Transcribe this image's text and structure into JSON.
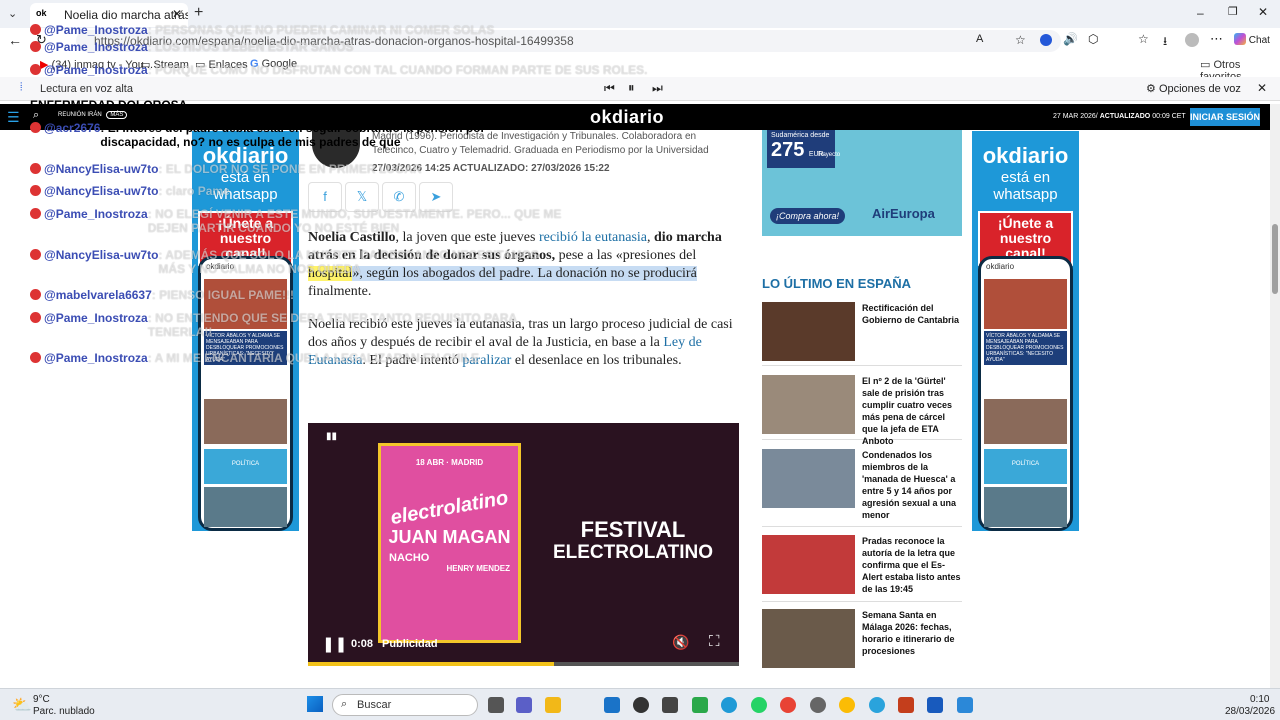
{
  "browser": {
    "tab_title": "Noelia dio marcha atrás en la",
    "url": "https://okdiario.com/espana/noelia-dio-marcha-atras-donacion-organos-hospital-16499358",
    "bookmarks": [
      "(34) inmaq tv - You...",
      "Stream",
      "Enlaces",
      "Google"
    ],
    "other_favorites": "Otros favoritos",
    "chat_label": "Chat"
  },
  "readaloud": {
    "label": "Lectura en voz alta",
    "voice_options": "Opciones de voz"
  },
  "site": {
    "logo": "okdiario",
    "ticker": "REUNIÓN IRÁN",
    "more": "MÁS",
    "date": "27 MAR 2026/",
    "updated_label": "ACTUALIZADO",
    "updated_time": "00:09",
    "tz": "CET",
    "login": "INICIAR SESIÓN"
  },
  "ad": {
    "brand": "okdiario",
    "line1": "está en",
    "line2": "whatsapp",
    "cta": "¡Únete a nuestro canal!",
    "phone_headline": "VÍCTOR ÁBALOS Y ALDAMA SE MENSAJEABAN PARA DESBLOQUEAR PROMOCIONES URBANÍSTICAS: \"NECESITO AYUDA\"",
    "phone_tag": "POLÍTICA"
  },
  "article": {
    "author_bio": "Madrid (1996). Periodista de Investigación y Tribunales. Colaboradora en Telecinco, Cuatro y Telemadrid. Graduada en Periodismo por la Universidad Complutense de...",
    "dates": "27/03/2026 14:25 ACTUALIZADO: 27/03/2026 15:22",
    "p1_a": "Noelia Castillo",
    "p1_b": ", la joven que este jueves ",
    "p1_link": "recibió la eutanasia",
    "p1_c": ", ",
    "p1_bold": "dio marcha atrás en la decisión de donar sus órganos,",
    "p1_d": " pese a las «presiones del ",
    "p1_hl_yellow": "hospital",
    "p1_hl_blue": "», según los abogados del padre. La donación no se producirá",
    "p1_e": " finalmente.",
    "p2_a": "Noelia recibió este jueves la eutanasia, tras un largo proceso judicial de casi dos años y después de recibir el aval de la Justicia, en base a la ",
    "p2_link": "Ley de Eutanasia",
    "p2_b": ". El padre intentó ",
    "p2_link2": "paralizar",
    "p2_c": " el desenlace en los tribunales."
  },
  "video": {
    "date_city": "18 ABR · MADRID",
    "poster_title": "electrolatino",
    "artist1": "JUAN MAGAN",
    "artist2": "NACHO",
    "artist3": "HENRY MENDEZ",
    "festival_l1": "FESTIVAL",
    "festival_l2": "ELECTROLATINO",
    "time": "0:08",
    "label": "Publicidad",
    "progress": 0.57
  },
  "sidebar": {
    "air_ad_top": "Sudamérica desde",
    "air_ad_price": "275",
    "air_ad_cur": "EUR",
    "air_ad_trip": "Trayecto",
    "air_ad_cta": "¡Compra ahora!",
    "air_ad_brand": "AirEuropa",
    "section_title": "LO ÚLTIMO EN ESPAÑA",
    "news": [
      {
        "title": "Rectificación del Gobierno de Cantabria",
        "color": "#5a3a2a"
      },
      {
        "title": "El nº 2 de la 'Gürtel' sale de prisión tras cumplir cuatro veces más pena de cárcel que la jefa de ETA Anboto",
        "color": "#9a8a7a"
      },
      {
        "title": "Condenados los miembros de la 'manada de Huesca' a entre 5 y 14 años por agresión sexual a una menor",
        "color": "#7a8a9a"
      },
      {
        "title": "Pradas reconoce la autoría de la letra que confirma que el Es-Alert estaba listo antes de las 19:45",
        "color": "#c23a3a"
      },
      {
        "title": "Semana Santa en Málaga 2026: fechas, horario e itinerario de procesiones",
        "color": "#6a5a4a"
      }
    ]
  },
  "chat": [
    {
      "user": "@Pame_Inostroza",
      "msg": ": PERSONAS QUE NO PUEDEN CAMINAR NI COMER SOLAS",
      "style": "faint"
    },
    {
      "user": "@Pame_Inostroza",
      "msg": ": LOS HIJOS DEBEN ESTAR SANOS",
      "style": "faint"
    },
    {
      "user": "@Pame_Inostroza",
      "msg": ": PORQUE COMO NO DISFRUTAN CON TAL CUANDO FORMAN PARTE DE SUS ROLES.",
      "style": "faint"
    },
    {
      "user": "",
      "msg": "ENFERMEDAD DOLOROSA.",
      "style": "dark"
    },
    {
      "user": "@acr2676",
      "msg": ": El interés del padre debía estar en seguir cobrando la pensión por discapacidad, no? no es culpa de mis padres de que",
      "style": "dark"
    },
    {
      "user": "@NancyElisa-uw7to",
      "msg": ": EL DOLOR NO SE PONE EN PRIMER LUGAR",
      "style": "faint"
    },
    {
      "user": "@NancyElisa-uw7to",
      "msg": ": claro Pame",
      "style": "faint"
    },
    {
      "user": "@Pame_Inostroza",
      "msg": ": NO ELEGÍ VENIR A ESTE MUNDO, SUPUESTAMENTE. PERO... QUE ME DEJEN PARTIR CUANDO YO NO ESTÉ BIEN",
      "style": "faint"
    },
    {
      "user": "@NancyElisa-uw7to",
      "msg": ": ADEMÁS QUE SOLO LA MUERTE DA DESCANSO NECESITAMOS MÁS Y NO CALMA NO NOS QUEDA",
      "style": "faint"
    },
    {
      "user": "@mabelvarela6637",
      "msg": ": PIENSO IGUAL PAME!!!",
      "style": "faint"
    },
    {
      "user": "@Pame_Inostroza",
      "msg": ": NO ENTIENDO QUE SE DEBA TENER TANTO REQUISITO PARA TENERLA!!",
      "style": "faint"
    },
    {
      "user": "@Pame_Inostroza",
      "msg": ": A MI ME ENCANTARÍA QUE LA LEGALIZARAN EN CHILE",
      "style": "faint"
    }
  ],
  "taskbar": {
    "temp": "9°C",
    "weather": "Parc. nublado",
    "search": "Buscar",
    "time": "0:10",
    "date": "28/03/2026"
  }
}
